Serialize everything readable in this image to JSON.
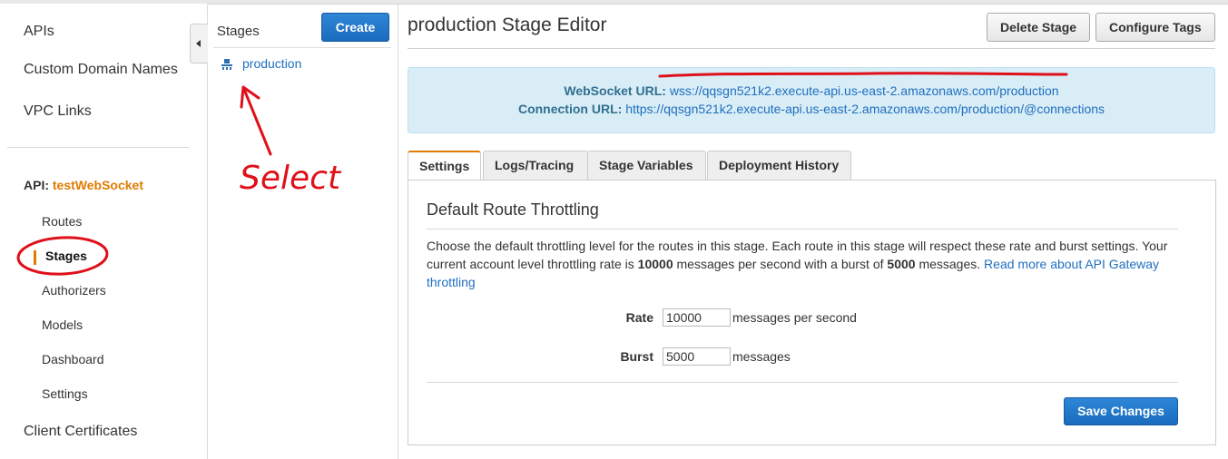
{
  "nav": {
    "top_items": [
      "APIs",
      "Custom Domain Names",
      "VPC Links"
    ],
    "api_prefix": "API:",
    "api_name": "testWebSocket",
    "sub_items": [
      "Routes",
      "Stages",
      "Authorizers",
      "Models",
      "Dashboard",
      "Settings"
    ],
    "active_item": "Stages",
    "bottom_item": "Client Certificates"
  },
  "stages": {
    "title": "Stages",
    "create_label": "Create",
    "items": [
      "production"
    ],
    "selected": "production"
  },
  "main": {
    "title": "production Stage Editor",
    "delete_label": "Delete Stage",
    "tags_label": "Configure Tags",
    "websocket_label": "WebSocket URL:",
    "websocket_url": "wss://qqsgn521k2.execute-api.us-east-2.amazonaws.com/production",
    "connection_label": "Connection URL:",
    "connection_url": "https://qqsgn521k2.execute-api.us-east-2.amazonaws.com/production/@connections",
    "tabs": [
      "Settings",
      "Logs/Tracing",
      "Stage Variables",
      "Deployment History"
    ],
    "active_tab": "Settings"
  },
  "throttling": {
    "title": "Default Route Throttling",
    "desc_1": "Choose the default throttling level for the routes in this stage. Each route in this stage will respect these rate and burst settings. Your current account level throttling rate is ",
    "rate_bold": "10000",
    "desc_2": " messages per second with a burst of ",
    "burst_bold": "5000",
    "desc_3": " messages. ",
    "link_text": "Read more about API Gateway throttling",
    "rate_label": "Rate",
    "rate_value": "10000",
    "rate_unit": "messages per second",
    "burst_label": "Burst",
    "burst_value": "5000",
    "burst_unit": "messages",
    "save_label": "Save Changes"
  },
  "annotation": {
    "text": "Select",
    "color": "#e0101a"
  }
}
